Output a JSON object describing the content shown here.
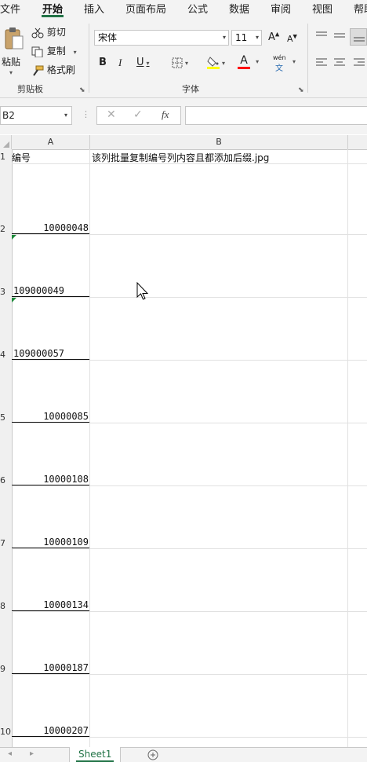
{
  "ribbon_tabs": [
    "文件",
    "开始",
    "插入",
    "页面布局",
    "公式",
    "数据",
    "审阅",
    "视图",
    "帮助"
  ],
  "clipboard": {
    "paste": "粘贴",
    "cut": "剪切",
    "copy": "复制",
    "format_painter": "格式刷",
    "group_label": "剪贴板"
  },
  "font": {
    "name": "宋体",
    "size": "11",
    "bold": "B",
    "italic": "I",
    "underline": "U",
    "font_color_glyph": "A",
    "phonetic_top": "wén",
    "phonetic_bottom": "文",
    "group_label": "字体"
  },
  "formula_bar": {
    "name_box": "B2",
    "fx": "fx",
    "value": ""
  },
  "grid": {
    "columns": [
      "A",
      "B"
    ],
    "header_row": {
      "row": "1",
      "a": "编号",
      "b": "该列批量复制编号列内容且都添加后缀.jpg"
    },
    "rows": [
      {
        "row": "2",
        "a": "10000048",
        "align": "right"
      },
      {
        "row": "3",
        "a": "109000049",
        "align": "left"
      },
      {
        "row": "4",
        "a": "109000057",
        "align": "left"
      },
      {
        "row": "5",
        "a": "10000085",
        "align": "right"
      },
      {
        "row": "6",
        "a": "10000108",
        "align": "right"
      },
      {
        "row": "7",
        "a": "10000109",
        "align": "right"
      },
      {
        "row": "8",
        "a": "10000134",
        "align": "right"
      },
      {
        "row": "9",
        "a": "10000187",
        "align": "right"
      },
      {
        "row": "10",
        "a": "10000207",
        "align": "right"
      }
    ]
  },
  "sheet_tabs": [
    "Sheet1"
  ],
  "colors": {
    "accent": "#217346",
    "highlight": "#ffff00",
    "font_color": "#ff0000",
    "error_triangle": "#1e8a3a"
  }
}
